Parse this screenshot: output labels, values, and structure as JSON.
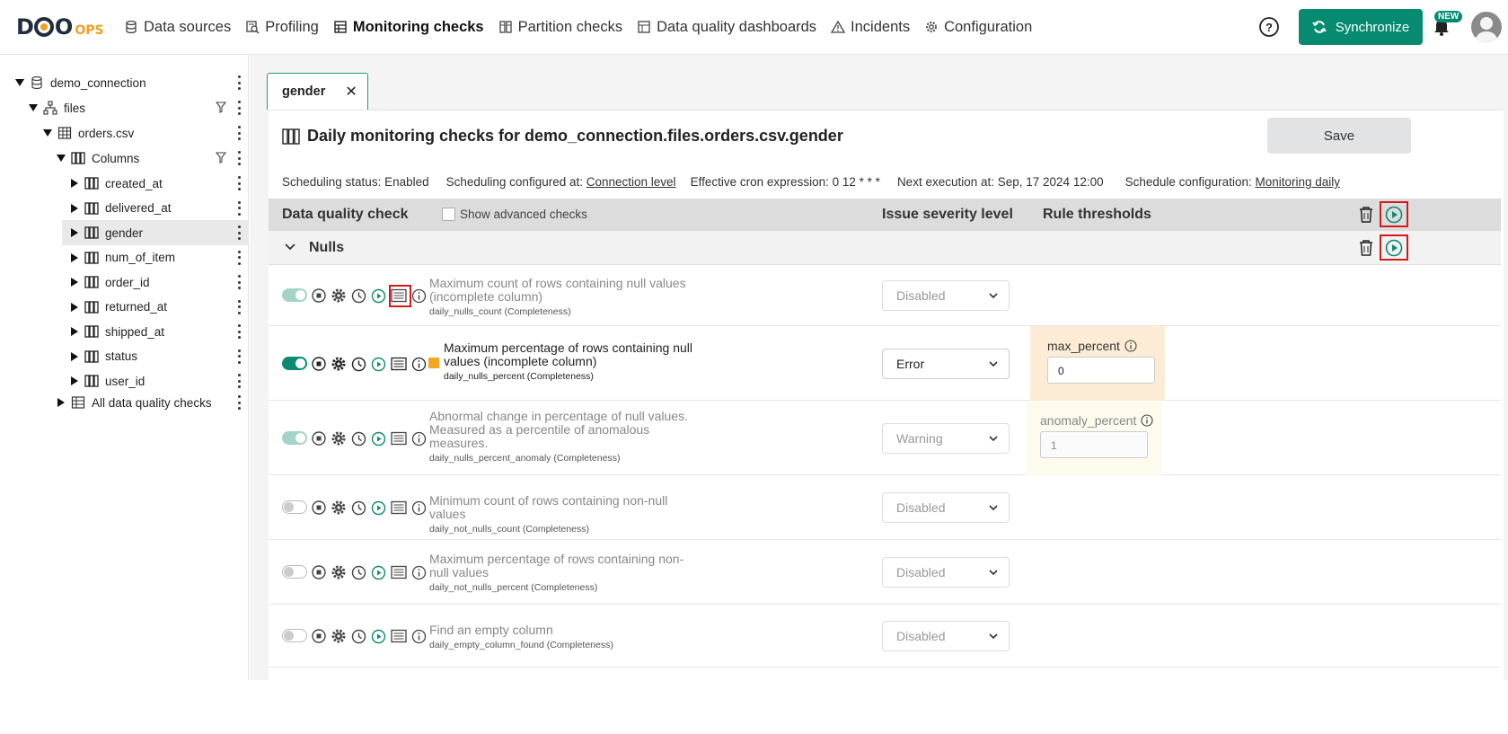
{
  "nav": {
    "logo_d": "D",
    "logo_q": "Q",
    "logo_ops": "Ops",
    "logo_o": "O",
    "items": [
      {
        "label": "Data sources",
        "icon": "database-icon"
      },
      {
        "label": "Profiling",
        "icon": "profiling-icon"
      },
      {
        "label": "Monitoring checks",
        "icon": "monitoring-icon",
        "active": true
      },
      {
        "label": "Partition checks",
        "icon": "partition-icon"
      },
      {
        "label": "Data quality dashboards",
        "icon": "dashboard-icon"
      },
      {
        "label": "Incidents",
        "icon": "warning-icon"
      },
      {
        "label": "Configuration",
        "icon": "gear-icon"
      }
    ],
    "sync_label": "Synchronize",
    "new_badge": "NEW"
  },
  "sidebar": {
    "connection": "demo_connection",
    "schema": "files",
    "table": "orders.csv",
    "columns_label": "Columns",
    "columns": [
      "created_at",
      "delivered_at",
      "gender",
      "num_of_item",
      "order_id",
      "returned_at",
      "shipped_at",
      "status",
      "user_id"
    ],
    "selected_column": "gender",
    "all_checks": "All data quality checks"
  },
  "tab": {
    "label": "gender",
    "close": "✕"
  },
  "panel": {
    "title": "Daily monitoring checks for demo_connection.files.orders.csv.gender",
    "save_label": "Save",
    "sched_status": "Scheduling status: Enabled",
    "sched_configured_prefix": "Scheduling configured at: ",
    "sched_configured_link": "Connection level",
    "cron": "Effective cron expression: 0 12 * * *",
    "next_exec": "Next execution at: Sep, 17 2024 12:00",
    "sched_config_prefix": "Schedule configuration: ",
    "sched_config_link": "Monitoring daily"
  },
  "table_head": {
    "check": "Data quality check",
    "advanced": "Show advanced checks",
    "severity": "Issue severity level",
    "thresholds": "Rule thresholds"
  },
  "group": {
    "name": "Nulls"
  },
  "checks": [
    {
      "title": "Maximum count of rows containing null values (incomplete column)",
      "sub": "daily_nulls_count (Completeness)",
      "toggle": "half",
      "severity": "Disabled",
      "active": false
    },
    {
      "title": "Maximum percentage of rows containing null values (incomplete column)",
      "sub": "daily_nulls_percent (Completeness)",
      "toggle": "on",
      "severity": "Error",
      "active": true,
      "threshold_label": "max_percent",
      "threshold_value": "0"
    },
    {
      "title": "Abnormal change in percentage of null values. Measured as a percentile of anomalous measures.",
      "sub": "daily_nulls_percent_anomaly (Completeness)",
      "toggle": "half",
      "severity": "Warning",
      "active": false,
      "threshold_label": "anomaly_percent",
      "threshold_value": "1"
    },
    {
      "title": "Minimum count of rows containing non-null values",
      "sub": "daily_not_nulls_count (Completeness)",
      "toggle": "off",
      "severity": "Disabled",
      "active": false
    },
    {
      "title": "Maximum percentage of rows containing non-null values",
      "sub": "daily_not_nulls_percent (Completeness)",
      "toggle": "off",
      "severity": "Disabled",
      "active": false
    },
    {
      "title": "Find an empty column",
      "sub": "daily_empty_column_found (Completeness)",
      "toggle": "off",
      "severity": "Disabled",
      "active": false
    }
  ],
  "colors": {
    "accent": "#068a70",
    "highlight": "#d21a1a",
    "error_bg": "#fdecd5",
    "warning_bg": "#fdfbee"
  }
}
